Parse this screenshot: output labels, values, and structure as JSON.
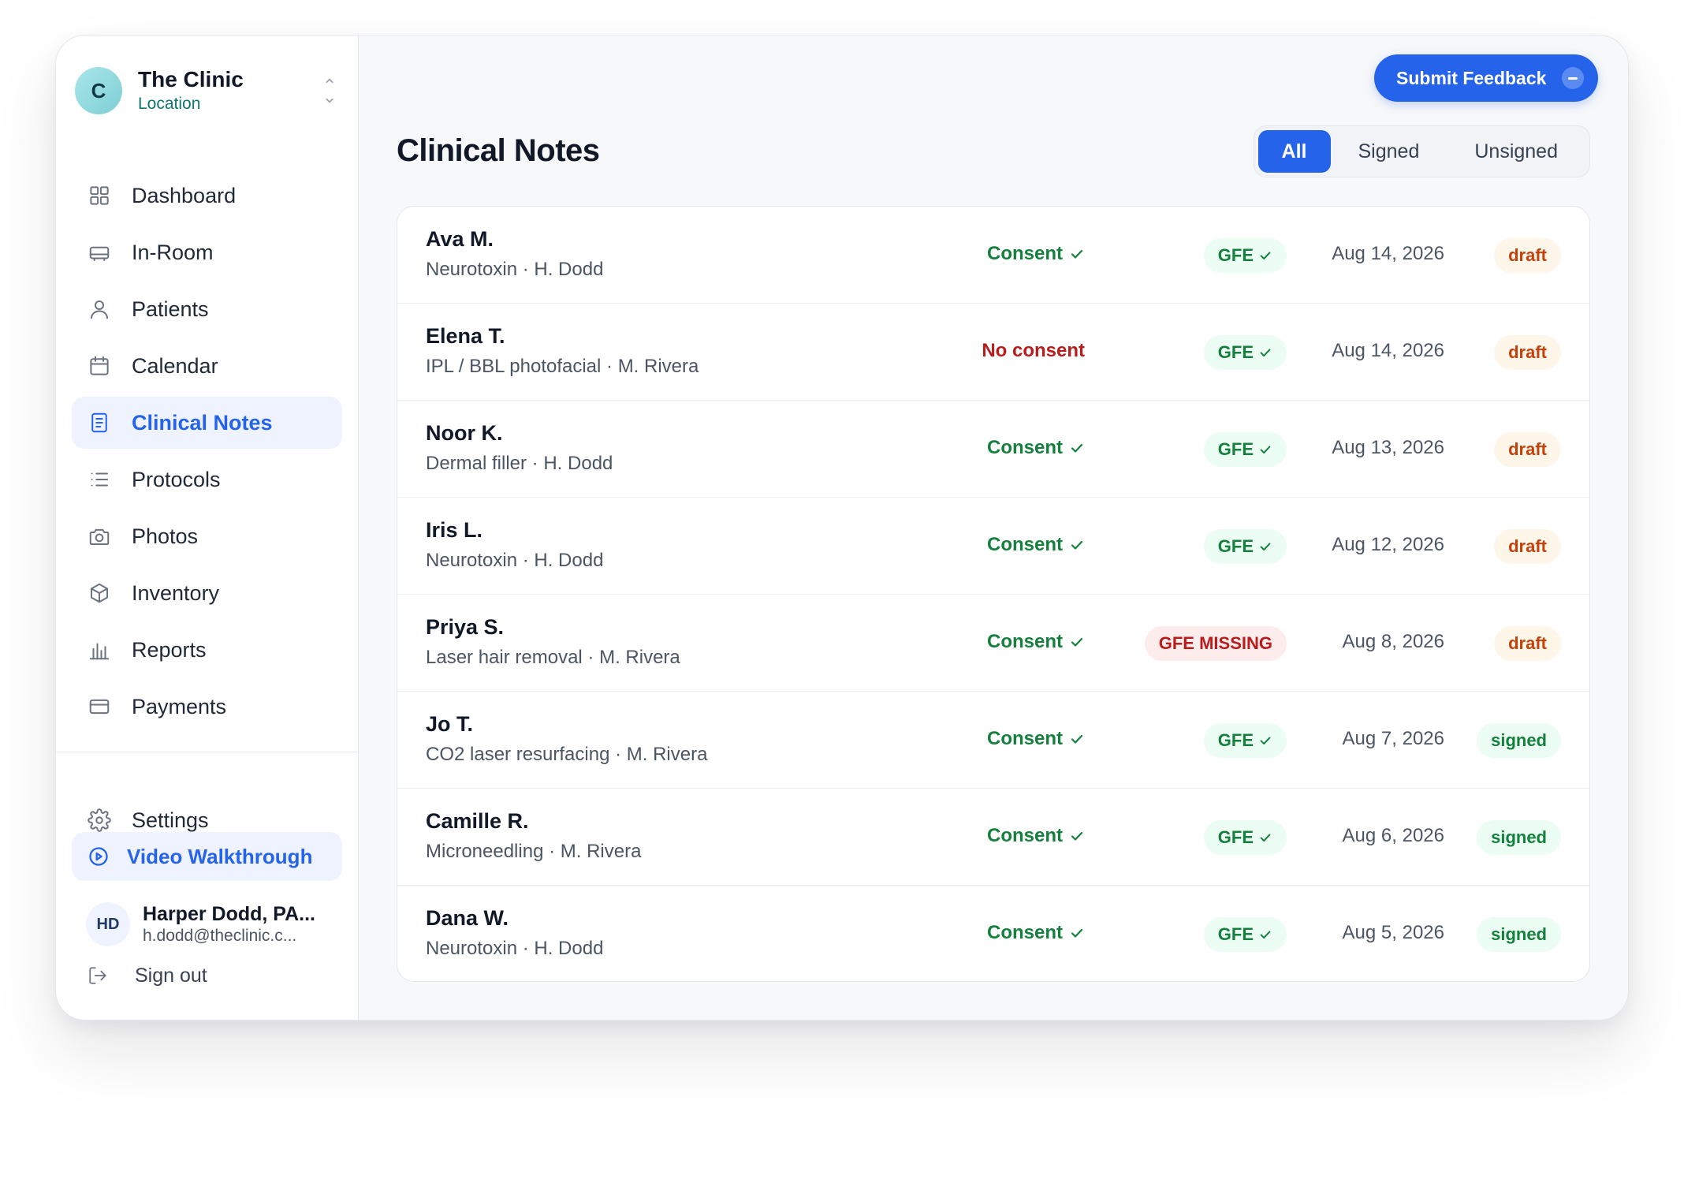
{
  "clinic": {
    "initial": "C",
    "name": "The Clinic",
    "location": "Location"
  },
  "nav": {
    "items": [
      {
        "label": "Dashboard",
        "icon": "grid-icon",
        "active": false
      },
      {
        "label": "In-Room",
        "icon": "monitor-icon",
        "active": false
      },
      {
        "label": "Patients",
        "icon": "user-icon",
        "active": false
      },
      {
        "label": "Calendar",
        "icon": "calendar-icon",
        "active": false
      },
      {
        "label": "Clinical Notes",
        "icon": "document-icon",
        "active": true
      },
      {
        "label": "Protocols",
        "icon": "list-icon",
        "active": false
      },
      {
        "label": "Photos",
        "icon": "camera-icon",
        "active": false
      },
      {
        "label": "Inventory",
        "icon": "box-icon",
        "active": false
      },
      {
        "label": "Reports",
        "icon": "bar-chart-icon",
        "active": false
      },
      {
        "label": "Payments",
        "icon": "credit-card-icon",
        "active": false
      }
    ],
    "settings_label": "Settings",
    "video_label": "Video Walkthrough"
  },
  "user": {
    "initials": "HD",
    "name": "Harper Dodd, PA...",
    "email": "h.dodd@theclinic.c...",
    "signout_label": "Sign out"
  },
  "header": {
    "feedback_label": "Submit Feedback",
    "title": "Clinical Notes",
    "filters": [
      "All",
      "Signed",
      "Unsigned"
    ],
    "active_filter": "All"
  },
  "notes": [
    {
      "name": "Ava M.",
      "detail": "Neurotoxin · H. Dodd",
      "consent": "Consent",
      "has_consent": true,
      "gfe": "GFE",
      "gfe_ok": true,
      "date": "Aug 14, 2026",
      "status": "draft"
    },
    {
      "name": "Elena T.",
      "detail": "IPL / BBL photofacial · M. Rivera",
      "consent": "No consent",
      "has_consent": false,
      "gfe": "GFE",
      "gfe_ok": true,
      "date": "Aug 14, 2026",
      "status": "draft"
    },
    {
      "name": "Noor K.",
      "detail": "Dermal filler · H. Dodd",
      "consent": "Consent",
      "has_consent": true,
      "gfe": "GFE",
      "gfe_ok": true,
      "date": "Aug 13, 2026",
      "status": "draft"
    },
    {
      "name": "Iris L.",
      "detail": "Neurotoxin · H. Dodd",
      "consent": "Consent",
      "has_consent": true,
      "gfe": "GFE",
      "gfe_ok": true,
      "date": "Aug 12, 2026",
      "status": "draft"
    },
    {
      "name": "Priya S.",
      "detail": "Laser hair removal · M. Rivera",
      "consent": "Consent",
      "has_consent": true,
      "gfe": "GFE MISSING",
      "gfe_ok": false,
      "date": "Aug 8, 2026",
      "status": "draft"
    },
    {
      "name": "Jo T.",
      "detail": "CO2 laser resurfacing · M. Rivera",
      "consent": "Consent",
      "has_consent": true,
      "gfe": "GFE",
      "gfe_ok": true,
      "date": "Aug 7, 2026",
      "status": "signed"
    },
    {
      "name": "Camille R.",
      "detail": "Microneedling · M. Rivera",
      "consent": "Consent",
      "has_consent": true,
      "gfe": "GFE",
      "gfe_ok": true,
      "date": "Aug 6, 2026",
      "status": "signed"
    },
    {
      "name": "Dana W.",
      "detail": "Neurotoxin · H. Dodd",
      "consent": "Consent",
      "has_consent": true,
      "gfe": "GFE",
      "gfe_ok": true,
      "date": "Aug 5, 2026",
      "status": "signed"
    }
  ],
  "colors": {
    "accent": "#2563eb",
    "accent_soft": "#eef3ff",
    "success": "#15803d",
    "danger": "#b91c1c",
    "draft": "#c2410c"
  }
}
